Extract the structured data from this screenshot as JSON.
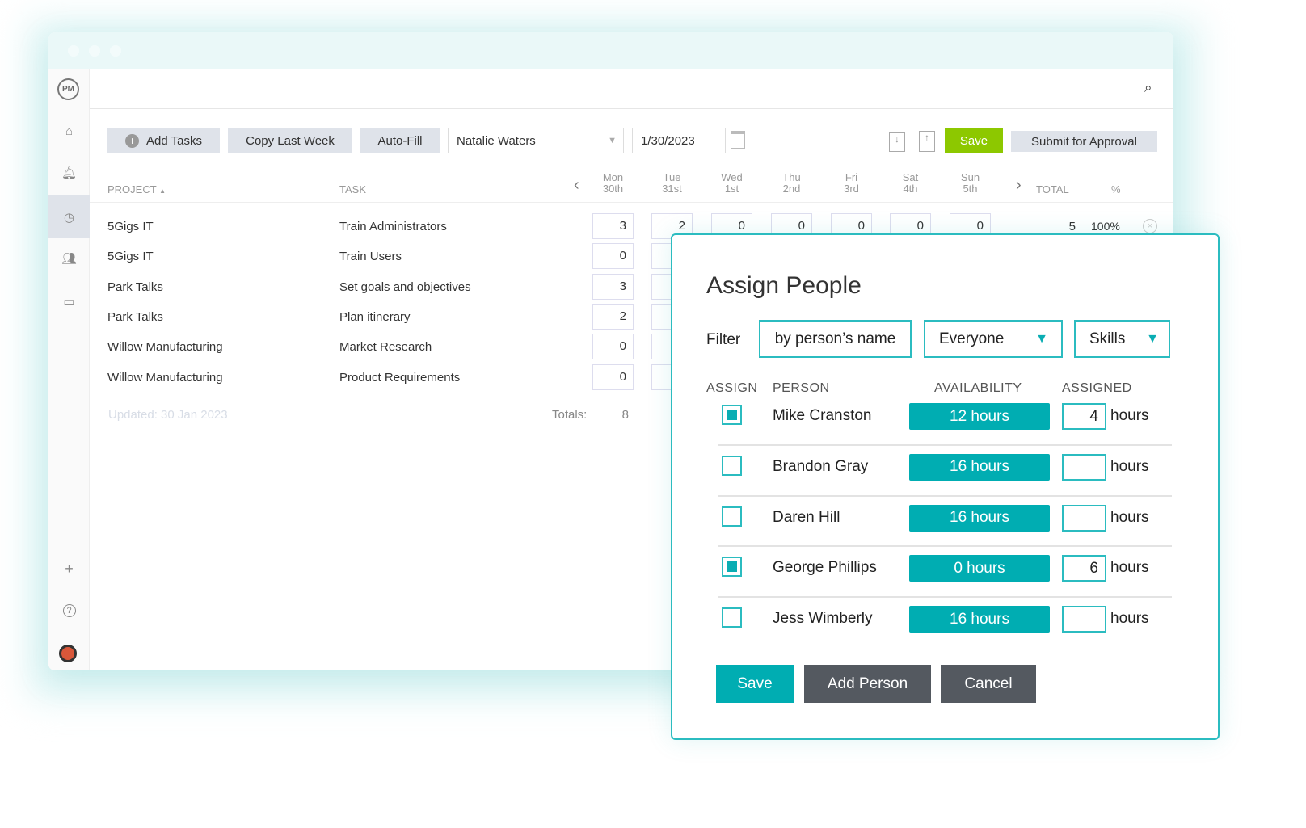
{
  "colors": {
    "accent": "#00adb2",
    "save_green": "#8dc800",
    "dark_button": "#545960"
  },
  "sidebar": {
    "logo": "PM",
    "items": [
      {
        "icon": "home-icon"
      },
      {
        "icon": "bell-icon"
      },
      {
        "icon": "clock-icon",
        "active": true
      },
      {
        "icon": "people-icon"
      },
      {
        "icon": "briefcase-icon"
      }
    ],
    "bottom": [
      {
        "icon": "plus-icon",
        "glyph": "+"
      },
      {
        "icon": "help-icon",
        "glyph": "?"
      }
    ]
  },
  "toolbar": {
    "add_tasks": "Add Tasks",
    "copy_last_week": "Copy Last Week",
    "auto_fill": "Auto-Fill",
    "user_select": "Natalie Waters",
    "date": "1/30/2023",
    "save": "Save",
    "submit": "Submit for Approval"
  },
  "table": {
    "headers": {
      "project": "PROJECT",
      "task": "TASK",
      "total": "TOTAL",
      "percent": "%"
    },
    "days": [
      {
        "d": "Mon",
        "n": "30th"
      },
      {
        "d": "Tue",
        "n": "31st"
      },
      {
        "d": "Wed",
        "n": "1st"
      },
      {
        "d": "Thu",
        "n": "2nd"
      },
      {
        "d": "Fri",
        "n": "3rd"
      },
      {
        "d": "Sat",
        "n": "4th"
      },
      {
        "d": "Sun",
        "n": "5th"
      }
    ],
    "rows": [
      {
        "project": "5Gigs IT",
        "task": "Train Administrators",
        "hours": [
          "3",
          "2",
          "0",
          "0",
          "0",
          "0",
          "0"
        ],
        "total": "5",
        "percent": "100%"
      },
      {
        "project": "5Gigs IT",
        "task": "Train Users",
        "hours": [
          "0"
        ]
      },
      {
        "project": "Park Talks",
        "task": "Set goals and objectives",
        "hours": [
          "3"
        ]
      },
      {
        "project": "Park Talks",
        "task": "Plan itinerary",
        "hours": [
          "2"
        ]
      },
      {
        "project": "Willow Manufacturing",
        "task": "Market Research",
        "hours": [
          "0"
        ]
      },
      {
        "project": "Willow Manufacturing",
        "task": "Product Requirements",
        "hours": [
          "0"
        ]
      }
    ],
    "updated": "Updated: 30 Jan 2023",
    "totals_label": "Totals:",
    "totals_mon": "8"
  },
  "modal": {
    "title": "Assign People",
    "filter_label": "Filter",
    "filter_name_placeholder": "by person’s name",
    "group_select": "Everyone",
    "skills_select": "Skills",
    "headers": {
      "assign": "ASSIGN",
      "person": "PERSON",
      "availability": "AVAILABILITY",
      "assigned": "ASSIGNED"
    },
    "people": [
      {
        "name": "Mike Cranston",
        "checked": true,
        "availability": "12 hours",
        "assigned": "4",
        "unit": "hours"
      },
      {
        "name": "Brandon Gray",
        "checked": false,
        "availability": "16 hours",
        "assigned": "",
        "unit": "hours"
      },
      {
        "name": "Daren Hill",
        "checked": false,
        "availability": "16 hours",
        "assigned": "",
        "unit": "hours"
      },
      {
        "name": "George Phillips",
        "checked": true,
        "availability": "0 hours",
        "assigned": "6",
        "unit": "hours"
      },
      {
        "name": "Jess Wimberly",
        "checked": false,
        "availability": "16 hours",
        "assigned": "",
        "unit": "hours"
      }
    ],
    "save": "Save",
    "add_person": "Add Person",
    "cancel": "Cancel"
  }
}
